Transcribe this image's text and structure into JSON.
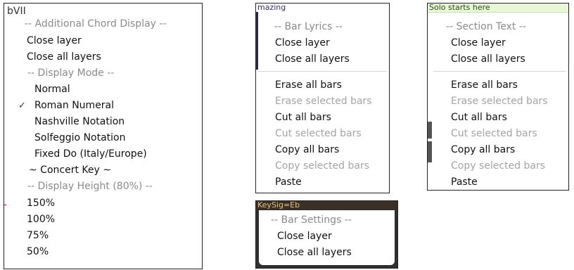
{
  "panels": [
    {
      "title": "bVII",
      "items": [
        {
          "label": "-- Additional Chord Display --",
          "kind": "header"
        },
        {
          "label": "Close layer",
          "kind": "item"
        },
        {
          "label": "Close all layers",
          "kind": "item"
        },
        {
          "label": "-- Display Mode --",
          "kind": "header"
        },
        {
          "label": "Normal",
          "kind": "item"
        },
        {
          "label": "Roman Numeral",
          "kind": "item",
          "checked": true
        },
        {
          "label": "Nashville Notation",
          "kind": "item"
        },
        {
          "label": "Solfeggio Notation",
          "kind": "item"
        },
        {
          "label": "Fixed Do (Italy/Europe)",
          "kind": "item"
        },
        {
          "label": "~ Concert Key ~",
          "kind": "item"
        },
        {
          "label": "-- Display Height (80%) --",
          "kind": "header"
        },
        {
          "label": "150%",
          "kind": "item"
        },
        {
          "label": "100%",
          "kind": "item"
        },
        {
          "label": "75%",
          "kind": "item"
        },
        {
          "label": "50%",
          "kind": "item"
        }
      ],
      "check_glyph": "✓"
    },
    {
      "strip_text": "mazing",
      "items": [
        {
          "label": "-- Bar Lyrics --",
          "kind": "header"
        },
        {
          "label": "Close layer",
          "kind": "item"
        },
        {
          "label": "Close all layers",
          "kind": "item"
        },
        {
          "label": "Erase all bars",
          "kind": "item"
        },
        {
          "label": "Erase selected bars",
          "kind": "disabled"
        },
        {
          "label": "Cut all bars",
          "kind": "item"
        },
        {
          "label": "Cut selected bars",
          "kind": "disabled"
        },
        {
          "label": "Copy all bars",
          "kind": "item"
        },
        {
          "label": "Copy selected bars",
          "kind": "disabled"
        },
        {
          "label": "Paste",
          "kind": "item"
        }
      ]
    },
    {
      "strip_text": "Solo starts here",
      "items": [
        {
          "label": "-- Section Text --",
          "kind": "header"
        },
        {
          "label": "Close layer",
          "kind": "item"
        },
        {
          "label": "Close all layers",
          "kind": "item"
        },
        {
          "label": "Erase all bars",
          "kind": "item"
        },
        {
          "label": "Erase selected bars",
          "kind": "disabled"
        },
        {
          "label": "Cut all bars",
          "kind": "item"
        },
        {
          "label": "Cut selected bars",
          "kind": "disabled"
        },
        {
          "label": "Copy all bars",
          "kind": "item"
        },
        {
          "label": "Copy selected bars",
          "kind": "disabled"
        },
        {
          "label": "Paste",
          "kind": "item"
        }
      ]
    },
    {
      "strip_text": "KeySig=Eb",
      "items": [
        {
          "label": "-- Bar Settings --",
          "kind": "header"
        },
        {
          "label": "Close layer",
          "kind": "item"
        },
        {
          "label": "Close all layers",
          "kind": "item"
        }
      ]
    }
  ]
}
